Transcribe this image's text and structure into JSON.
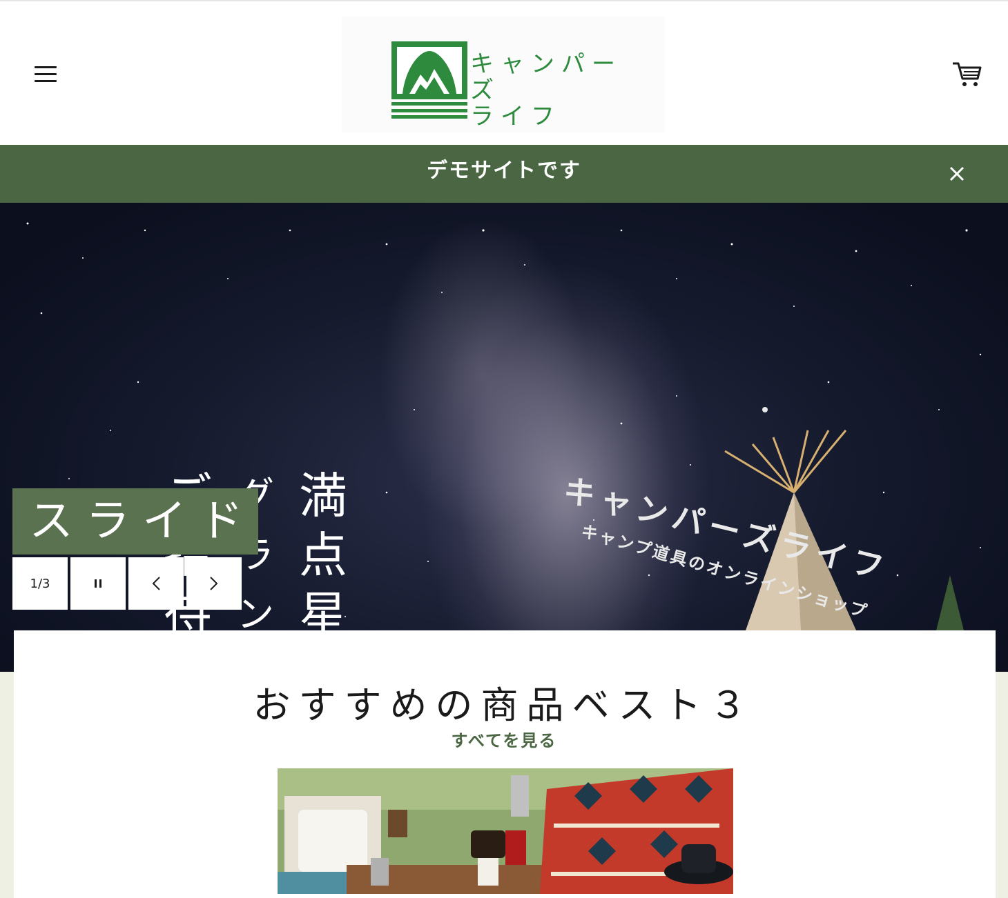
{
  "header": {
    "menu_icon": "hamburger-menu-icon",
    "logo_text_line1": "キャンパーズ",
    "logo_text_line2": "ライフ",
    "cart_icon": "cart-icon"
  },
  "announcement": {
    "text": "デモサイトです",
    "close_icon": "close-icon"
  },
  "hero": {
    "vertical_lines": [
      "満点星空",
      "グランピング",
      "ご招待"
    ],
    "brand": "キャンパーズライフ",
    "tagline": "キャンプ道具のオンラインショップ",
    "slide_title": "スライド",
    "counter": "1/3",
    "pause_icon": "pause-icon",
    "prev_icon": "chevron-left-icon",
    "next_icon": "chevron-right-icon"
  },
  "featured": {
    "title": "おすすめの商品ベスト３",
    "view_all": "すべてを見る"
  },
  "colors": {
    "brand_green": "#2e8b3e",
    "announce_bg": "#4a6643",
    "slide_title_bg": "#5a7250",
    "page_bg": "#eef0e4"
  }
}
